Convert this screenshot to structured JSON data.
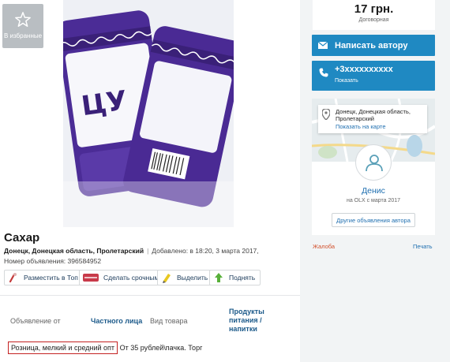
{
  "favorites": {
    "label": "В избранные",
    "icon": "star-icon"
  },
  "listing": {
    "title": "Сахар",
    "location": "Донецк, Донецкая область, Пролетарский",
    "added": "Добавлено: в 18:20, 3 марта 2017,",
    "ad_number": "Номер объявления: 396584952"
  },
  "promo": {
    "top": "Разместить в Топ",
    "urgent": "Сделать срочным",
    "highlight": "Выделить",
    "raise": "Поднять"
  },
  "params": {
    "offered_by_label": "Объявление от",
    "offered_by_value": "Частного лица",
    "goods_type_label": "Вид товара",
    "goods_type_value": "Продукты питания / напитки"
  },
  "description": {
    "highlighted": "Розница, мелкий и средний опт",
    "rest": "От 35 рублей\\пачка. Торг"
  },
  "sidebar": {
    "price": "17 грн.",
    "negotiable": "Договорная",
    "message_button": "Написать автору",
    "phone": "+3xxxxxxxxxx",
    "show_label": "Показать",
    "map_address": "Донецк, Донецкая область, Пролетарский",
    "map_link": "Показать на карте",
    "seller_name": "Денис",
    "seller_since": "на OLX с марта 2017",
    "other_ads": "Другие объявления автора",
    "complain": "Жалоба",
    "print": "Печать"
  },
  "colors": {
    "accent": "#1f89c2",
    "link": "#1f6fb0",
    "complain": "#d2502c",
    "highlight_border": "#c42222"
  }
}
